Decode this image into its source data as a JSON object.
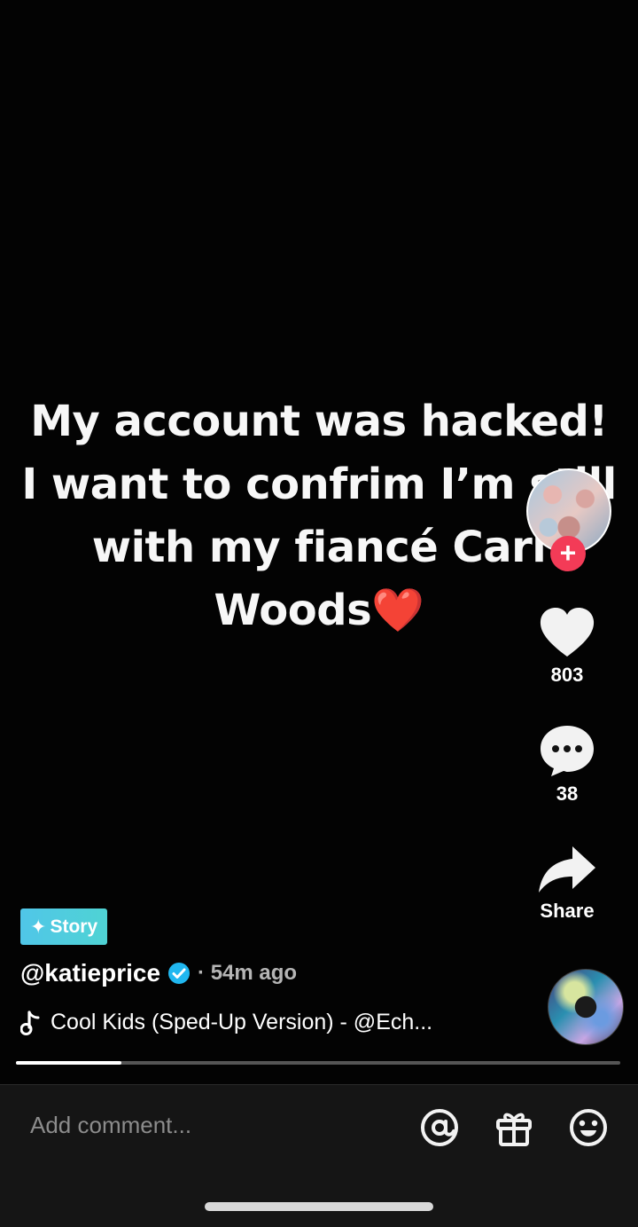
{
  "caption": {
    "line1": "My account was hacked!",
    "line2": "I want to confrim I’m still",
    "line3": "with my fiancé Carl",
    "line4": "Woods",
    "heart": "❤️"
  },
  "actions": {
    "like_count": "803",
    "comment_count": "38",
    "share_label": "Share"
  },
  "post": {
    "badge": "Story",
    "badge_icon": "✦",
    "author": "@katieprice",
    "time": "· 54m ago",
    "music": "Cool Kids (Sped-Up Version) - @Ech..."
  },
  "playback": {
    "progress": 0.175
  },
  "comment_bar": {
    "placeholder": "Add comment..."
  },
  "colors": {
    "accent": "#f33b57",
    "badge": "#50c6e8",
    "verified": "#20b7f0"
  },
  "icons": [
    "plus-icon",
    "heart-icon",
    "comment-icon",
    "share-icon",
    "verified-icon",
    "music-note-icon",
    "mention-icon",
    "gift-icon",
    "emoji-icon"
  ]
}
